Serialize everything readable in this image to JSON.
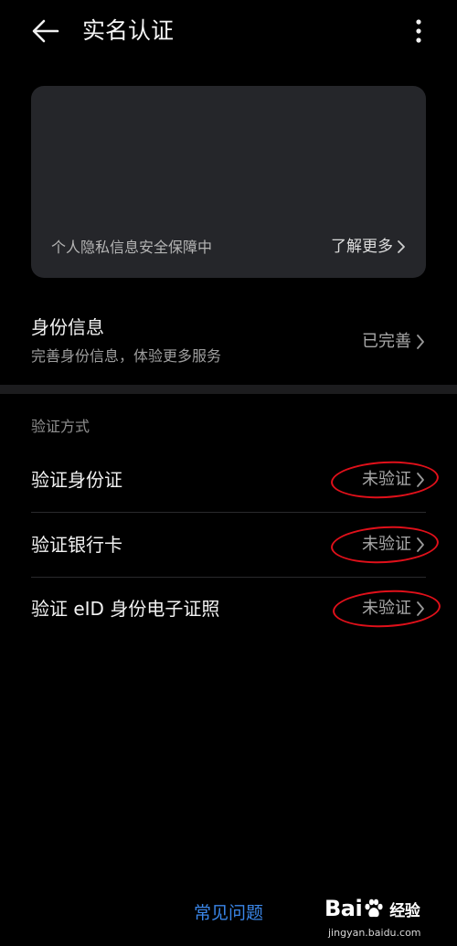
{
  "header": {
    "title": "实名认证",
    "back_icon": "arrow-left-icon",
    "more_icon": "more-vertical-icon"
  },
  "banner": {
    "privacy_text": "个人隐私信息安全保障中",
    "learn_more_label": "了解更多"
  },
  "identity": {
    "title": "身份信息",
    "subtitle": "完善身份信息，体验更多服务",
    "status": "已完善"
  },
  "verification": {
    "section_label": "验证方式",
    "items": [
      {
        "label": "验证身份证",
        "status": "未验证"
      },
      {
        "label": "验证银行卡",
        "status": "未验证"
      },
      {
        "label": "验证 eID 身份电子证照",
        "status": "未验证"
      }
    ]
  },
  "footer": {
    "faq_label": "常见问题"
  },
  "watermark": {
    "logo_part1": "Bai",
    "logo_part2": "经验",
    "url": "jingyan.baidu.com"
  },
  "colors": {
    "background": "#000000",
    "card": "#25262a",
    "link_blue": "#3a86e8",
    "annotation_red": "#e0101a"
  }
}
